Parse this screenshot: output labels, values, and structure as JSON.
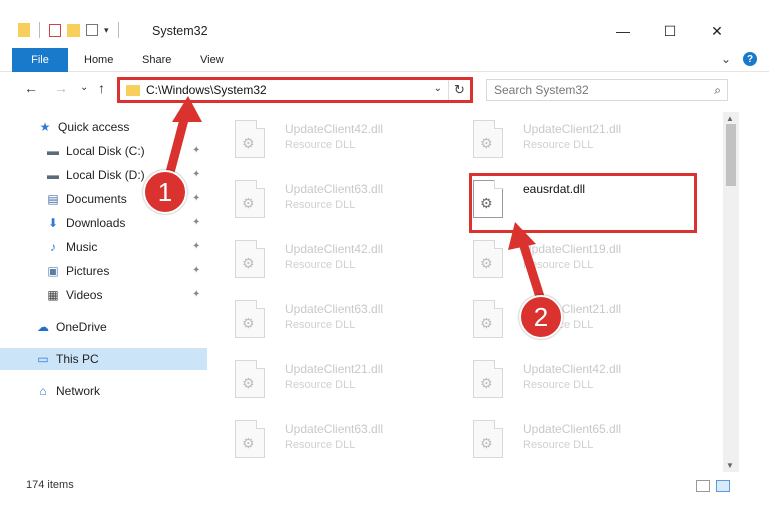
{
  "window": {
    "title": "System32",
    "minimize_glyph": "—",
    "maximize_glyph": "☐",
    "close_glyph": "✕"
  },
  "ribbon": {
    "file_tab": "File",
    "tabs": [
      "Home",
      "Share",
      "View"
    ],
    "expand_glyph": "⌄",
    "help_glyph": "?"
  },
  "navigation": {
    "back_glyph": "←",
    "forward_glyph": "→",
    "recent_glyph": "⌄",
    "up_glyph": "↑",
    "address": "C:\\Windows\\System32",
    "address_dropdown_glyph": "⌄",
    "refresh_glyph": "↻",
    "search_placeholder": "Search System32",
    "search_glyph": "⌕"
  },
  "sidebar": {
    "items": [
      {
        "label": "Quick access",
        "icon": "star-icon",
        "glyph": "★",
        "color": "#2e7bd6"
      },
      {
        "label": "Local Disk (C:)",
        "icon": "drive-icon",
        "glyph": "▬",
        "color": "#5a6b7b",
        "pinned": true
      },
      {
        "label": "Local Disk (D:)",
        "icon": "drive-icon",
        "glyph": "▬",
        "color": "#5a6b7b",
        "pinned": true
      },
      {
        "label": "Documents",
        "icon": "documents-icon",
        "glyph": "▤",
        "color": "#4a6fa5",
        "pinned": true
      },
      {
        "label": "Downloads",
        "icon": "download-icon",
        "glyph": "⬇",
        "color": "#2e7bd6",
        "pinned": true
      },
      {
        "label": "Music",
        "icon": "music-icon",
        "glyph": "♪",
        "color": "#2e7bd6",
        "pinned": true
      },
      {
        "label": "Pictures",
        "icon": "pictures-icon",
        "glyph": "▣",
        "color": "#5a7ea8",
        "pinned": true
      },
      {
        "label": "Videos",
        "icon": "videos-icon",
        "glyph": "▦",
        "color": "#444444",
        "pinned": true
      },
      {
        "label": "OneDrive",
        "icon": "cloud-icon",
        "glyph": "☁",
        "color": "#1d6fc9"
      },
      {
        "label": "This PC",
        "icon": "computer-icon",
        "glyph": "▭",
        "color": "#2e7bd6",
        "selected": true
      },
      {
        "label": "Network",
        "icon": "network-icon",
        "glyph": "⌂",
        "color": "#2e7bd6"
      }
    ],
    "pin_glyph": "📌"
  },
  "files": {
    "left_column": [
      {
        "name": "UpdateClient42.dll",
        "type": "Resource DLL"
      },
      {
        "name": "UpdateClient63.dll",
        "type": "Resource DLL"
      },
      {
        "name": "UpdateClient42.dll",
        "type": "Resource DLL"
      },
      {
        "name": "UpdateClient63.dll",
        "type": "Resource DLL"
      },
      {
        "name": "UpdateClient21.dll",
        "type": "Resource DLL"
      },
      {
        "name": "UpdateClient63.dll",
        "type": "Resource DLL"
      }
    ],
    "right_column": [
      {
        "name": "UpdateClient21.dll",
        "type": "Resource DLL"
      },
      {
        "name": "eausrdat.dll",
        "type": "",
        "focus": true
      },
      {
        "name": "UpdateClient19.dll",
        "type": "Resource DLL"
      },
      {
        "name": "UpdateClient21.dll",
        "type": "Resource DLL"
      },
      {
        "name": "UpdateClient42.dll",
        "type": "Resource DLL"
      },
      {
        "name": "UpdateClient65.dll",
        "type": "Resource DLL"
      }
    ],
    "gear_glyph": "⚙"
  },
  "status": {
    "item_count": "174 items"
  },
  "annotations": {
    "callout_1": "1",
    "callout_2": "2",
    "highlight_color": "#d9322f"
  }
}
